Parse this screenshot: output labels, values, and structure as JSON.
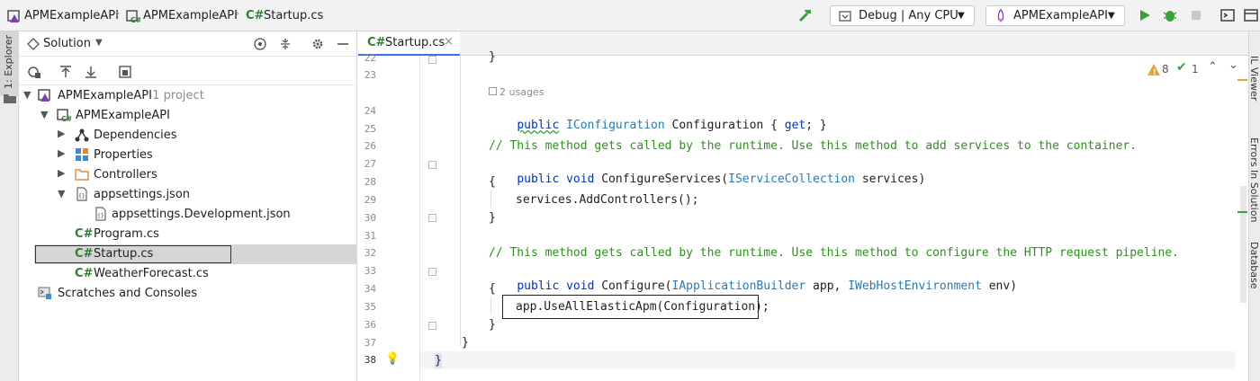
{
  "breadcrumb": {
    "items": [
      "APMExampleAPI",
      "APMExampleAPI",
      "Startup.cs"
    ],
    "cs_badge": "C#"
  },
  "toolbar": {
    "configuration": "Debug | Any CPU",
    "run_target": "APMExampleAPI"
  },
  "left_strip": {
    "explorer_label": "1: Explorer"
  },
  "right_strip": {
    "il_viewer": "IL Viewer",
    "errors": "Errors In Solution",
    "database": "Database"
  },
  "explorer": {
    "title": "Solution",
    "tree": [
      {
        "label": "APMExampleAPI",
        "suffix": " · 1 project"
      },
      {
        "label": "APMExampleAPI"
      },
      {
        "label": "Dependencies"
      },
      {
        "label": "Properties"
      },
      {
        "label": "Controllers"
      },
      {
        "label": "appsettings.json"
      },
      {
        "label": "appsettings.Development.json"
      },
      {
        "label": "Program.cs",
        "badge": "C#"
      },
      {
        "label": "Startup.cs",
        "badge": "C#"
      },
      {
        "label": "WeatherForecast.cs",
        "badge": "C#"
      },
      {
        "label": "Scratches and Consoles"
      }
    ]
  },
  "editor": {
    "tab_label": "Startup.cs",
    "tab_badge": "C#",
    "warnings": "8",
    "checks": "1",
    "usages_hint": "2 usages",
    "line_numbers": [
      "22",
      "23",
      "24",
      "25",
      "26",
      "27",
      "28",
      "29",
      "30",
      "31",
      "32",
      "33",
      "34",
      "35",
      "36",
      "37",
      "38"
    ],
    "lines": {
      "l22": "}",
      "l24_kw": "public",
      "l24_type": "IConfiguration",
      "l24_rest": " Configuration { ",
      "l24_get": "get",
      "l24_end": "; }",
      "l26": "// This method gets called by the runtime. Use this method to add services to the container.",
      "l27_kw": "public void",
      "l27_name": " ConfigureServices(",
      "l27_type": "IServiceCollection",
      "l27_rest": " services)",
      "l28": "{",
      "l29": "services.AddControllers();",
      "l30": "}",
      "l32": "// This method gets called by the runtime. Use this method to configure the HTTP request pipeline.",
      "l33_kw": "public void",
      "l33_name": " Configure(",
      "l33_type1": "IApplicationBuilder",
      "l33_mid": " app, ",
      "l33_type2": "IWebHostEnvironment",
      "l33_rest": " env)",
      "l34": "{",
      "l35": "app.UseAllElasticApm(Configuration);",
      "l36": "}",
      "l37": "}",
      "l38": "}"
    }
  },
  "colors": {
    "accent": "#3574f0",
    "keyword": "#0033b3",
    "type": "#2a7ab0",
    "comment": "#2f8f1f",
    "run": "#3aa13a"
  }
}
